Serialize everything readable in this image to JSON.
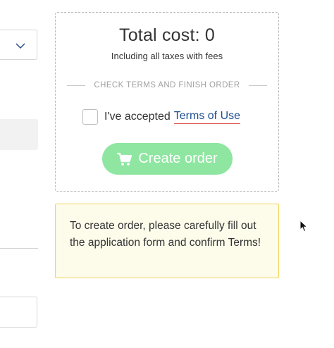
{
  "order": {
    "total_label": "Total cost: 0",
    "taxes_note": "Including all taxes with fees",
    "section_label": "CHECK TERMS AND FINISH ORDER",
    "terms_prefix": "I've accepted",
    "terms_link": "Terms of Use",
    "terms_checked": false,
    "create_button": "Create order"
  },
  "warning": {
    "message": "To create order, please carefully fill out the application form and confirm Terms!"
  },
  "colors": {
    "button_bg": "#8ee6a0",
    "link": "#1f4f8f",
    "link_underline": "#e0564d",
    "warning_bg": "#fdfbea",
    "warning_border": "#f1d35f"
  },
  "icons": [
    "chevron-down-icon",
    "cart-icon",
    "mouse-pointer-icon"
  ]
}
